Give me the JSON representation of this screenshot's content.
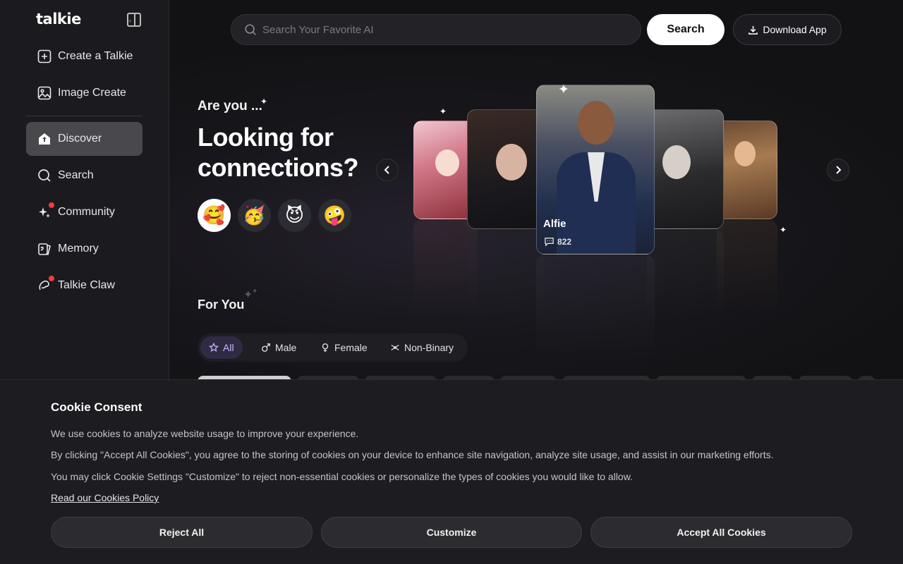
{
  "brand": {
    "logo": "talkie"
  },
  "sidebar": {
    "top_items": [
      {
        "label": "Create a Talkie",
        "icon": "plus-square-icon"
      },
      {
        "label": "Image Create",
        "icon": "image-icon"
      }
    ],
    "items": [
      {
        "label": "Discover",
        "icon": "home-icon",
        "active": true
      },
      {
        "label": "Search",
        "icon": "search-icon"
      },
      {
        "label": "Community",
        "icon": "sparkles-icon",
        "dot": true
      },
      {
        "label": "Memory",
        "icon": "memory-icon"
      },
      {
        "label": "Talkie Claw",
        "icon": "claw-icon",
        "dot": true
      }
    ]
  },
  "header": {
    "search_placeholder": "Search Your Favorite AI",
    "search_button": "Search",
    "download_button": "Download App"
  },
  "hero": {
    "subtitle": "Are you ...",
    "title": "Looking for connections?",
    "emojis": [
      "🥰",
      "🥳",
      "😈",
      "🤪"
    ],
    "featured_card": {
      "name": "Alfie",
      "count": "822"
    }
  },
  "for_you": {
    "title": "For You",
    "filters": [
      {
        "label": "All",
        "icon": "star-icon",
        "active": true
      },
      {
        "label": "Male",
        "icon": "male-icon"
      },
      {
        "label": "Female",
        "icon": "female-icon"
      },
      {
        "label": "Non-Binary",
        "icon": "non-binary-icon"
      }
    ]
  },
  "cookie": {
    "title": "Cookie Consent",
    "lines": [
      "We use cookies to analyze website usage to improve your experience.",
      "By clicking \"Accept All Cookies\", you agree to the storing of cookies on your device to enhance site navigation, analyze site usage, and assist in our marketing efforts.",
      "You may click Cookie Settings \"Customize\" to reject non-essential cookies or personalize the types of cookies you would like to allow."
    ],
    "policy_link": "Read our Cookies Policy",
    "buttons": {
      "reject": "Reject All",
      "customize": "Customize",
      "accept": "Accept All Cookies"
    }
  },
  "colors": {
    "accent": "#c9b8ff",
    "notification": "#ef3e3e",
    "background": "#121214"
  }
}
